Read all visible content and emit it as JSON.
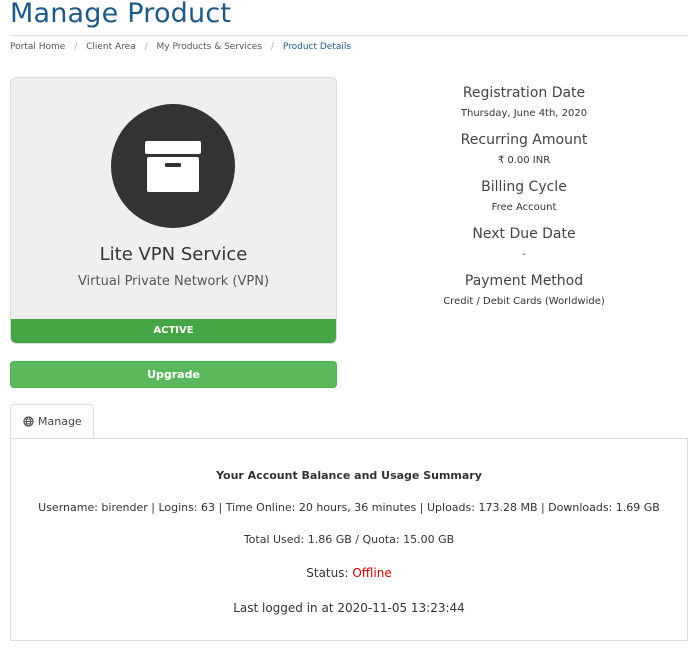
{
  "page": {
    "title": "Manage Product"
  },
  "breadcrumb": [
    {
      "label": "Portal Home",
      "active": false
    },
    {
      "label": "Client Area",
      "active": false
    },
    {
      "label": "My Products & Services",
      "active": false
    },
    {
      "label": "Product Details",
      "active": true
    }
  ],
  "product": {
    "icon": "archive-box-icon",
    "name": "Lite VPN Service",
    "group": "Virtual Private Network (VPN)",
    "status": "ACTIVE",
    "upgrade_label": "Upgrade"
  },
  "details": [
    {
      "label": "Registration Date",
      "value": "Thursday, June 4th, 2020"
    },
    {
      "label": "Recurring Amount",
      "value": "₹ 0.00 INR"
    },
    {
      "label": "Billing Cycle",
      "value": "Free Account"
    },
    {
      "label": "Next Due Date",
      "value": "-"
    },
    {
      "label": "Payment Method",
      "value": "Credit / Debit Cards (Worldwide)"
    }
  ],
  "tabs": {
    "manage_label": "Manage",
    "manage_icon": "globe-icon"
  },
  "usage": {
    "title": "Your Account Balance and Usage Summary",
    "usage_line": "Username: birender | Logins: 63 | Time Online: 20 hours, 36 minutes | Uploads: 173.28 MB | Downloads: 1.69 GB",
    "quota_line": "Total Used: 1.86 GB / Quota: 15.00 GB",
    "status_label": "Status: ",
    "status_value": "Offline",
    "last_login": "Last logged in at 2020-11-05 13:23:44"
  },
  "colors": {
    "title": "#1f5a85",
    "active_bar": "#45a545",
    "upgrade_button": "#5cb85c",
    "offline": "#cc0000"
  }
}
